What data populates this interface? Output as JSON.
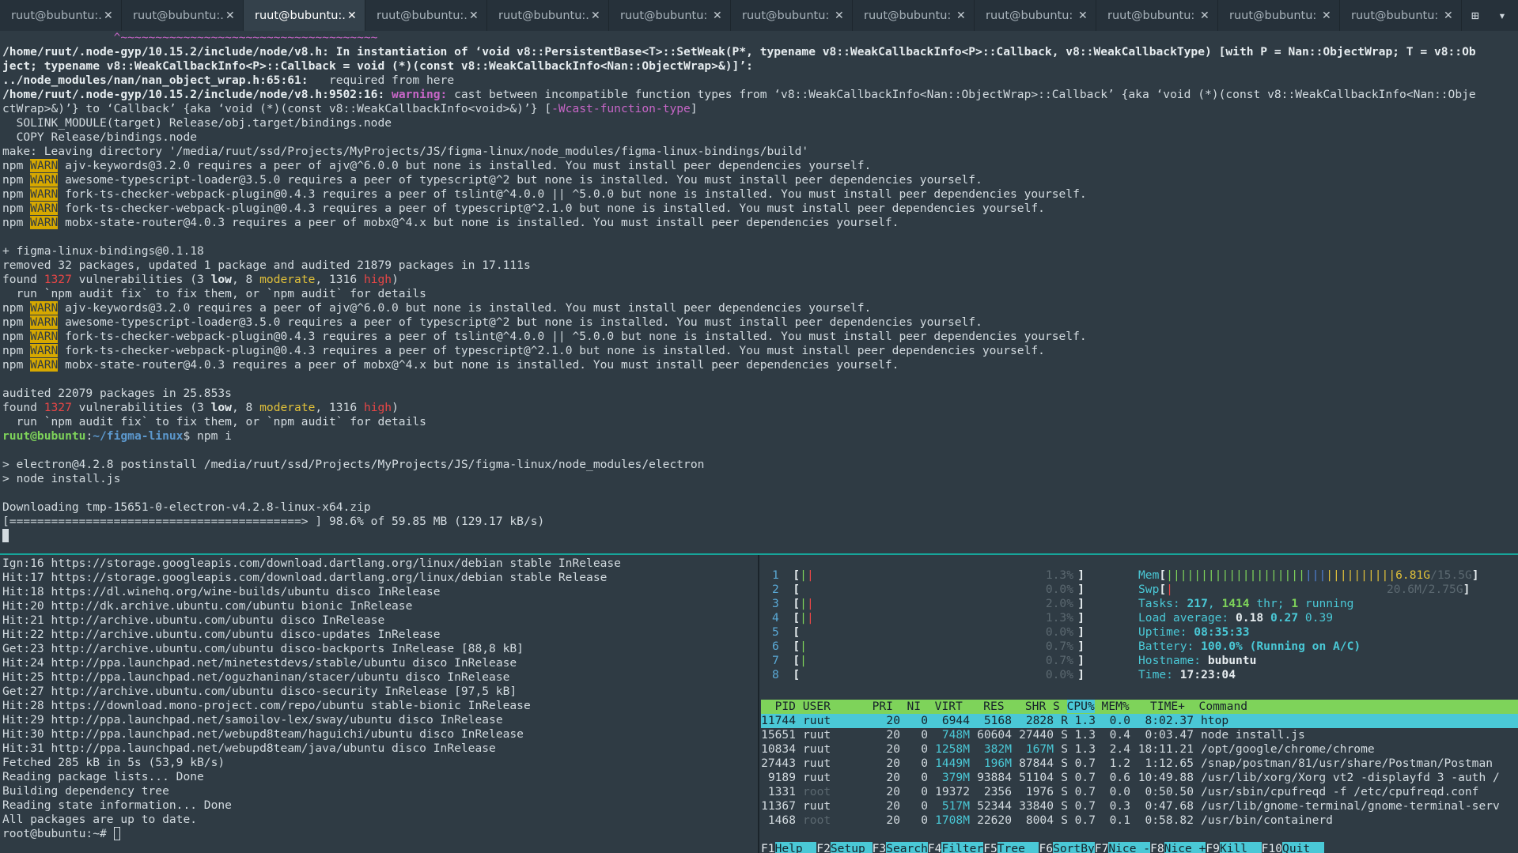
{
  "tabs": [
    {
      "label": "ruut@bubuntu:...",
      "active": false
    },
    {
      "label": "ruut@bubuntu:...",
      "active": false
    },
    {
      "label": "ruut@bubuntu:...",
      "active": true
    },
    {
      "label": "ruut@bubuntu:...",
      "active": false
    },
    {
      "label": "ruut@bubuntu:...",
      "active": false
    },
    {
      "label": "ruut@bubuntu: ~",
      "active": false
    },
    {
      "label": "ruut@bubuntu: ~",
      "active": false
    },
    {
      "label": "ruut@bubuntu: ~",
      "active": false
    },
    {
      "label": "ruut@bubuntu: ~",
      "active": false
    },
    {
      "label": "ruut@bubuntu: ~",
      "active": false
    },
    {
      "label": "ruut@bubuntu: ~",
      "active": false
    },
    {
      "label": "ruut@bubuntu: ~",
      "active": false
    }
  ],
  "icons": {
    "tab_close": "close-icon",
    "new_tab": "new-tab-icon",
    "tab_menu": "chevron-down-icon"
  },
  "colors": {
    "background": "#2f3b44",
    "accent": "#17a59a",
    "warn": "#d6a800",
    "htop_green": "#7ed35a",
    "htop_cyan": "#4ac8d6"
  },
  "top_terminal": {
    "tilde_line": "                ^~~~~~~~~~~~~~~~~~~~~~~~~~~~~~~~~~~~~~",
    "l1": "/home/ruut/.node-gyp/10.15.2/include/node/v8.h: In instantiation of ‘void v8::PersistentBase<T>::SetWeak(P*, typename v8::WeakCallbackInfo<P>::Callback, v8::WeakCallbackType) [with P = Nan::ObjectWrap; T = v8::Ob",
    "l2": "ject; typename v8::WeakCallbackInfo<P>::Callback = void (*)(const v8::WeakCallbackInfo<Nan::ObjectWrap>&)]’:",
    "l3a": "../node_modules/nan/nan_object_wrap.h:65:61:",
    "l3b": "   required from here",
    "l4a": "/home/ruut/.node-gyp/10.15.2/include/node/v8.h:9502:16: ",
    "l4b": "warning: ",
    "l4c": "cast between incompatible function types from ‘v8::WeakCallbackInfo<Nan::ObjectWrap>::Callback’ {aka ‘void (*)(const v8::WeakCallbackInfo<Nan::Obje",
    "l5a": "ctWrap>&)’} to ‘Callback’ {aka ‘void (*)(const v8::WeakCallbackInfo<void>&)’} [",
    "l5b": "-Wcast-function-type",
    "l5c": "]",
    "l6": "  SOLINK_MODULE(target) Release/obj.target/bindings.node",
    "l7": "  COPY Release/bindings.node",
    "l8": "make: Leaving directory '/media/ruut/ssd/Projects/MyProjects/JS/figma-linux/node_modules/figma-linux-bindings/build'",
    "npm": "npm",
    "warn": "WARN",
    "w1": " ajv-keywords@3.2.0 requires a peer of ajv@^6.0.0 but none is installed. You must install peer dependencies yourself.",
    "w2": " awesome-typescript-loader@3.5.0 requires a peer of typescript@^2 but none is installed. You must install peer dependencies yourself.",
    "w3": " fork-ts-checker-webpack-plugin@0.4.3 requires a peer of tslint@^4.0.0 || ^5.0.0 but none is installed. You must install peer dependencies yourself.",
    "w4": " fork-ts-checker-webpack-plugin@0.4.3 requires a peer of typescript@^2.1.0 but none is installed. You must install peer dependencies yourself.",
    "w5": " mobx-state-router@4.0.3 requires a peer of mobx@^4.x but none is installed. You must install peer dependencies yourself.",
    "plus": "+ figma-linux-bindings@0.1.18",
    "removed": "removed 32 packages, updated 1 package and audited 21879 packages in 17.111s",
    "found": "found ",
    "vcount": "1327",
    "vtext": " vulnerabilities (3 ",
    "low": "low",
    "c8": ", 8 ",
    "moderate": "moderate",
    "c1316": ", 1316 ",
    "high": "high",
    "close": ")",
    "auditfix": "  run `npm audit fix` to fix them, or `npm audit` for details",
    "audited": "audited 22079 packages in 25.853s",
    "prompt_user": "ruut@bubuntu",
    "prompt_sep": ":",
    "prompt_path": "~/figma-linux",
    "prompt_cmd": "$ npm i",
    "post1": "> electron@4.2.8 postinstall /media/ruut/ssd/Projects/MyProjects/JS/figma-linux/node_modules/electron",
    "post2": "> node install.js",
    "dl": "Downloading tmp-15651-0-electron-v4.2.8-linux-x64.zip",
    "progress": "[==========================================> ] 98.6% of 59.85 MB (129.17 kB/s)",
    "progress_pct": 98.6
  },
  "apt_lines": [
    "Ign:16 https://storage.googleapis.com/download.dartlang.org/linux/debian stable InRelease",
    "Hit:17 https://storage.googleapis.com/download.dartlang.org/linux/debian stable Release",
    "Hit:18 https://dl.winehq.org/wine-builds/ubuntu disco InRelease",
    "Hit:20 http://dk.archive.ubuntu.com/ubuntu bionic InRelease",
    "Hit:21 http://archive.ubuntu.com/ubuntu disco InRelease",
    "Hit:22 http://archive.ubuntu.com/ubuntu disco-updates InRelease",
    "Get:23 http://archive.ubuntu.com/ubuntu disco-backports InRelease [88,8 kB]",
    "Hit:24 http://ppa.launchpad.net/minetestdevs/stable/ubuntu disco InRelease",
    "Hit:25 http://ppa.launchpad.net/oguzhaninan/stacer/ubuntu disco InRelease",
    "Get:27 http://archive.ubuntu.com/ubuntu disco-security InRelease [97,5 kB]",
    "Hit:28 https://download.mono-project.com/repo/ubuntu stable-bionic InRelease",
    "Hit:29 http://ppa.launchpad.net/samoilov-lex/sway/ubuntu disco InRelease",
    "Hit:30 http://ppa.launchpad.net/webupd8team/haguichi/ubuntu disco InRelease",
    "Hit:31 http://ppa.launchpad.net/webupd8team/java/ubuntu disco InRelease",
    "Fetched 285 kB in 5s (53,9 kB/s)",
    "Reading package lists... Done",
    "Building dependency tree",
    "Reading state information... Done",
    "All packages are up to date."
  ],
  "apt_prompt": "root@bubuntu:~# ",
  "htop": {
    "cpus": [
      {
        "n": "1",
        "bars": "||",
        "pct": "1.3%"
      },
      {
        "n": "2",
        "bars": "",
        "pct": "0.0%"
      },
      {
        "n": "3",
        "bars": "||",
        "pct": "2.0%"
      },
      {
        "n": "4",
        "bars": "||",
        "pct": "1.3%"
      },
      {
        "n": "5",
        "bars": "",
        "pct": "0.0%"
      },
      {
        "n": "6",
        "bars": "|",
        "pct": "0.7%"
      },
      {
        "n": "7",
        "bars": "|",
        "pct": "0.7%"
      },
      {
        "n": "8",
        "bars": "",
        "pct": "0.0%"
      }
    ],
    "mem_label": "Mem",
    "mem_bars_g": "||||||||||||||||||||",
    "mem_bars_b": "|||",
    "mem_bars_y": "||||||||||",
    "mem_val": "6.81G",
    "mem_total": "/15.5G",
    "swp_label": "Swp",
    "swp_bars": "|",
    "swp_val": "20.6M/2.75G",
    "tasks_label": "Tasks: ",
    "tasks": "217",
    "tasks_sep": ", ",
    "thr": "1414",
    "thr_label": " thr; ",
    "running": "1",
    "running_label": " running",
    "load_label": "Load average: ",
    "load1": "0.18",
    "load5": "0.27",
    "load15": "0.39",
    "uptime_label": "Uptime: ",
    "uptime": "08:35:33",
    "battery_label": "Battery: ",
    "battery": "100.0% (Running on A/C)",
    "hostname_label": "Hostname: ",
    "hostname": "bubuntu",
    "time_label": "Time: ",
    "time": "17:23:04",
    "header_pre": "  PID USER      PRI  NI  VIRT   RES   SHR S ",
    "header_sel": "CPU%",
    "header_post": " MEM%   TIME+  Command",
    "procs": [
      {
        "pid": "11744",
        "user": "ruut",
        "pri": "20",
        "ni": "0",
        "virt": "6944",
        "res": "5168",
        "shr": "2828",
        "s": "R",
        "cpu": "1.3",
        "mem": "0.0",
        "time": "8:02.37",
        "cmd": "htop",
        "sel": true
      },
      {
        "pid": "15651",
        "user": "ruut",
        "pri": "20",
        "ni": "0",
        "virt": "748M",
        "res": "60604",
        "shr": "27440",
        "s": "S",
        "cpu": "1.3",
        "mem": "0.4",
        "time": "0:03.47",
        "cmd": "node install.js"
      },
      {
        "pid": "10834",
        "user": "ruut",
        "pri": "20",
        "ni": "0",
        "virt": "1258M",
        "res": "382M",
        "shr": "167M",
        "s": "S",
        "cpu": "1.3",
        "mem": "2.4",
        "time": "18:11.21",
        "cmd": "/opt/google/chrome/chrome"
      },
      {
        "pid": "27443",
        "user": "ruut",
        "pri": "20",
        "ni": "0",
        "virt": "1449M",
        "res": "196M",
        "shr": "87844",
        "s": "S",
        "cpu": "0.7",
        "mem": "1.2",
        "time": "1:12.65",
        "cmd": "/snap/postman/81/usr/share/Postman/Postman"
      },
      {
        "pid": "9189",
        "user": "ruut",
        "pri": "20",
        "ni": "0",
        "virt": "379M",
        "res": "93884",
        "shr": "51104",
        "s": "S",
        "cpu": "0.7",
        "mem": "0.6",
        "time": "10:49.88",
        "cmd": "/usr/lib/xorg/Xorg vt2 -displayfd 3 -auth /"
      },
      {
        "pid": "1331",
        "user": "root",
        "pri": "20",
        "ni": "0",
        "virt": "19372",
        "res": "2356",
        "shr": "1976",
        "s": "S",
        "cpu": "0.7",
        "mem": "0.0",
        "time": "0:50.50",
        "cmd": "/usr/sbin/cpufreqd -f /etc/cpufreqd.conf"
      },
      {
        "pid": "11367",
        "user": "ruut",
        "pri": "20",
        "ni": "0",
        "virt": "517M",
        "res": "52344",
        "shr": "33840",
        "s": "S",
        "cpu": "0.7",
        "mem": "0.3",
        "time": "0:47.68",
        "cmd": "/usr/lib/gnome-terminal/gnome-terminal-serv"
      },
      {
        "pid": "1468",
        "user": "root",
        "pri": "20",
        "ni": "0",
        "virt": "1708M",
        "res": "22620",
        "shr": "8004",
        "s": "S",
        "cpu": "0.7",
        "mem": "0.1",
        "time": "0:58.82",
        "cmd": "/usr/bin/containerd"
      }
    ],
    "fkeys": [
      {
        "k": "F1",
        "l": "Help  "
      },
      {
        "k": "F2",
        "l": "Setup "
      },
      {
        "k": "F3",
        "l": "Search"
      },
      {
        "k": "F4",
        "l": "Filter"
      },
      {
        "k": "F5",
        "l": "Tree  "
      },
      {
        "k": "F6",
        "l": "SortBy"
      },
      {
        "k": "F7",
        "l": "Nice -"
      },
      {
        "k": "F8",
        "l": "Nice +"
      },
      {
        "k": "F9",
        "l": "Kill  "
      },
      {
        "k": "F10",
        "l": "Quit  "
      }
    ]
  }
}
